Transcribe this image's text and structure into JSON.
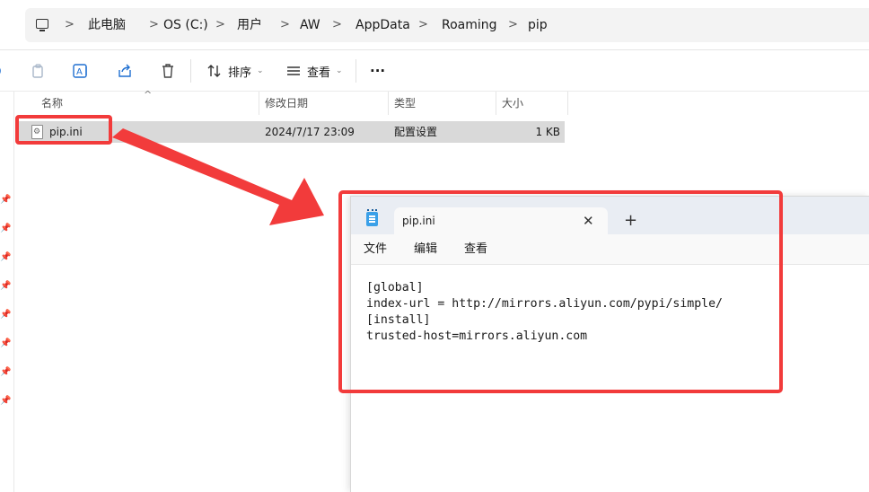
{
  "address_bar": {
    "icon": "computer-icon",
    "crumbs": [
      "此电脑",
      "OS (C:)",
      "用户",
      "AW",
      "AppData",
      "Roaming",
      "pip"
    ],
    "separator": ">"
  },
  "toolbar": {
    "icons": [
      "new-icon",
      "copy-icon",
      "rename-icon",
      "share-icon",
      "delete-icon"
    ],
    "sort_label": "排序",
    "view_label": "查看",
    "more_label": "···"
  },
  "file_list": {
    "columns": [
      "名称",
      "修改日期",
      "类型",
      "大小"
    ],
    "rows": [
      {
        "name": "pip.ini",
        "modified": "2024/7/17 23:09",
        "type": "配置设置",
        "size": "1 KB"
      }
    ]
  },
  "notepad": {
    "tab_title": "pip.ini",
    "close_glyph": "✕",
    "new_tab_glyph": "+",
    "menu": [
      "文件",
      "编辑",
      "查看"
    ],
    "lines": [
      "[global]",
      "index-url = http://mirrors.aliyun.com/pypi/simple/",
      "[install]",
      "trusted-host=mirrors.aliyun.com"
    ]
  },
  "annotations": {
    "highlight_color": "#f23b3b"
  }
}
